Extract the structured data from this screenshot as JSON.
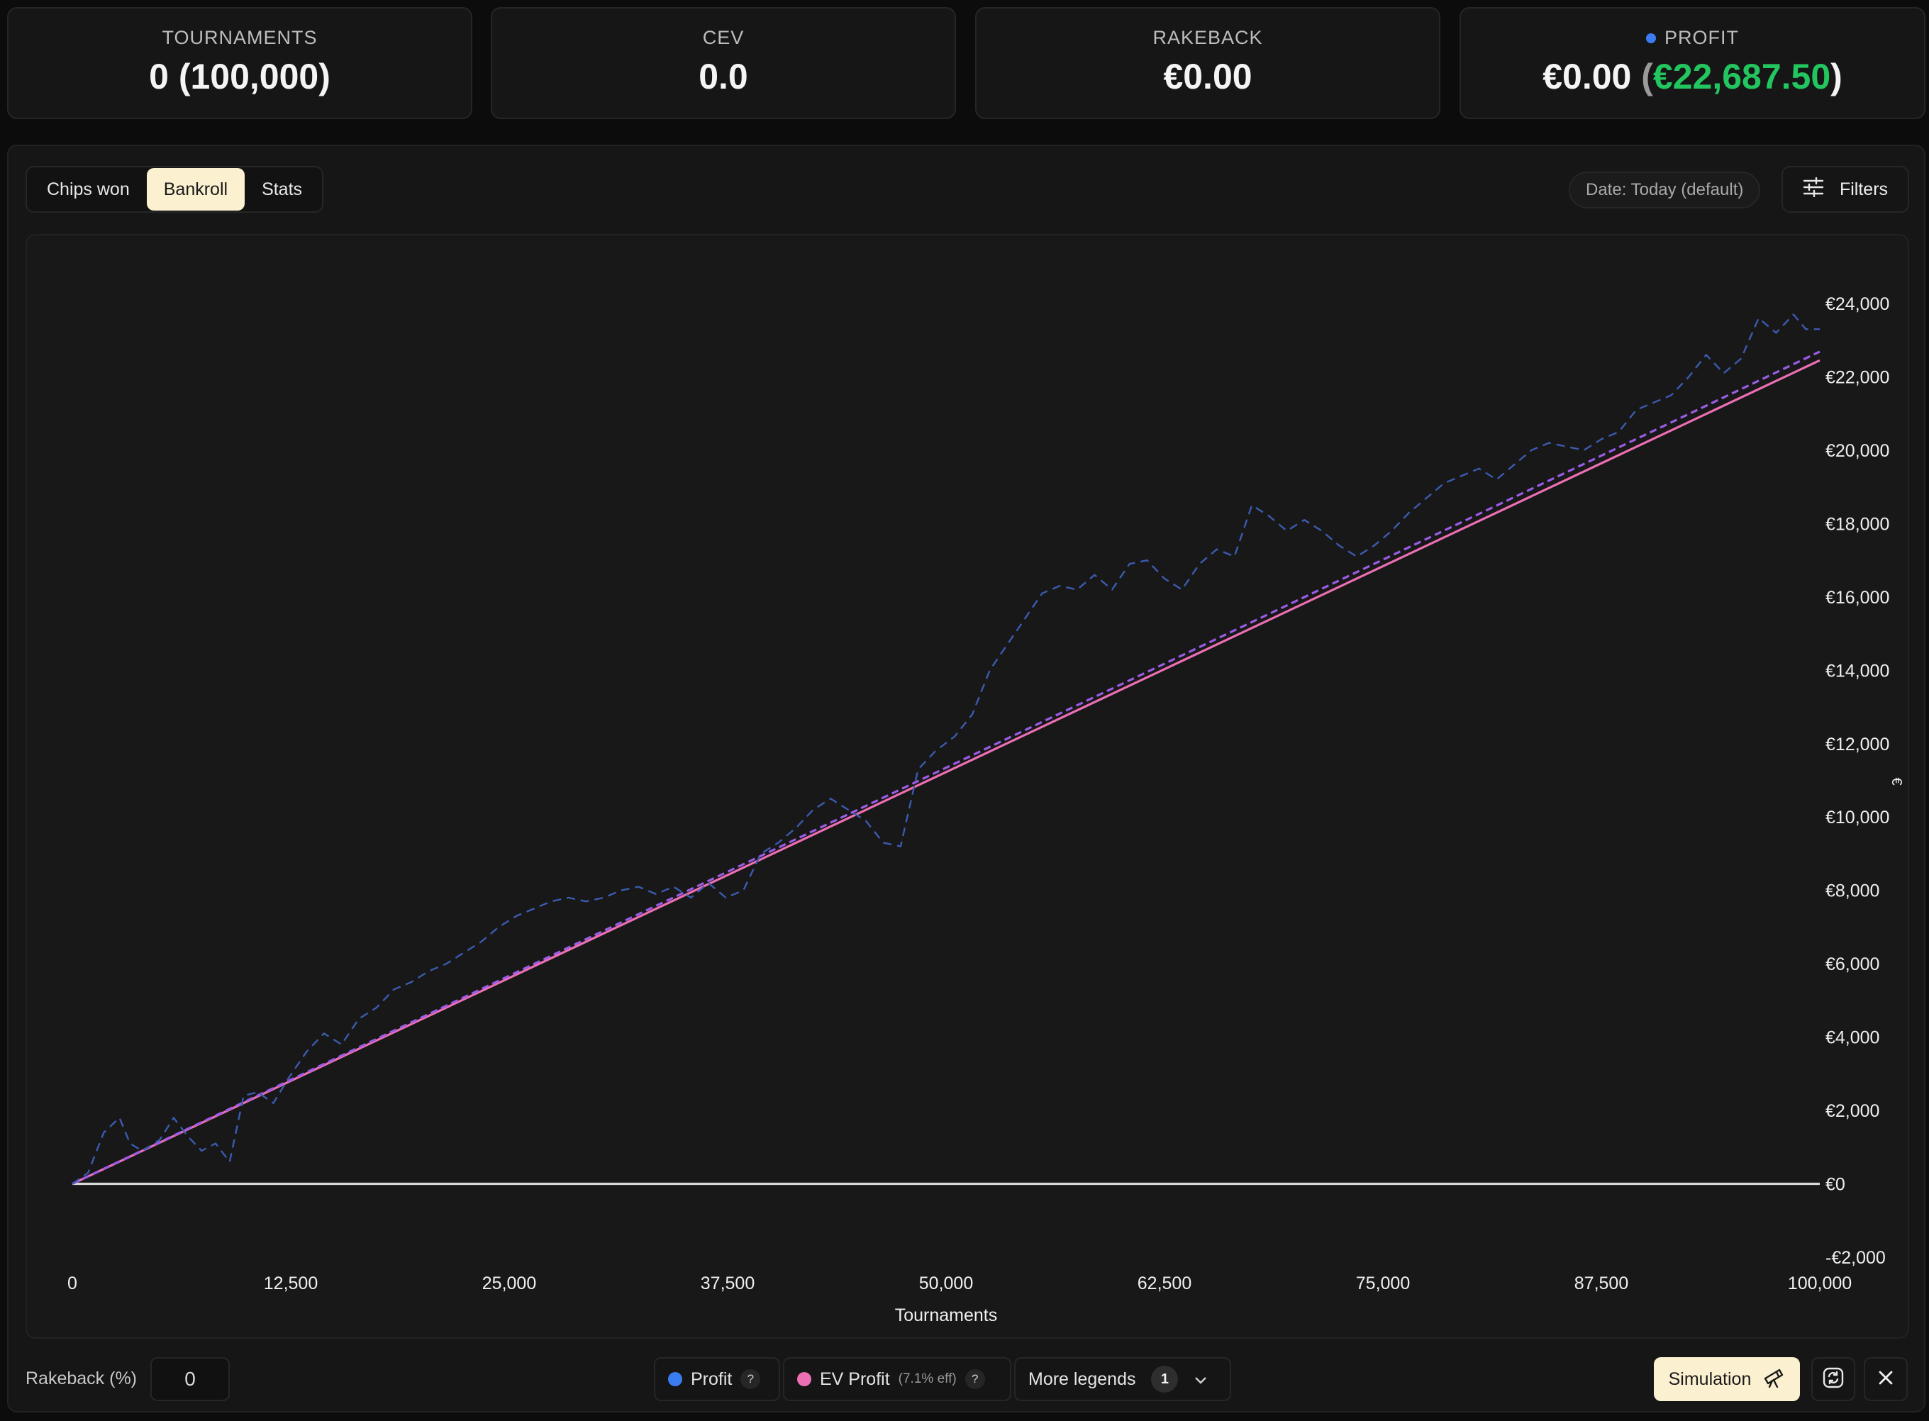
{
  "stats": {
    "tournaments": {
      "label": "TOURNAMENTS",
      "value": "0 (100,000)"
    },
    "cev": {
      "label": "CEV",
      "value": "0.0"
    },
    "rakeback": {
      "label": "RAKEBACK",
      "value": "€0.00"
    },
    "profit": {
      "label": "PROFIT",
      "value": "€0.00",
      "paren_open": "(",
      "expected": "€22,687.50",
      "paren_close": ")",
      "dot_color": "#3b7cf0",
      "expected_color": "#22c55e"
    }
  },
  "tabs": [
    {
      "label": "Chips won",
      "active": false
    },
    {
      "label": "Bankroll",
      "active": true
    },
    {
      "label": "Stats",
      "active": false
    }
  ],
  "date_filter": "Date: Today (default)",
  "filters_label": "Filters",
  "chart_data": {
    "type": "line",
    "xlabel": "Tournaments",
    "ylabel": "€",
    "xlim": [
      0,
      100000
    ],
    "ylim": [
      -2000,
      24000
    ],
    "x_ticks": [
      "0",
      "12,500",
      "25,000",
      "37,500",
      "50,000",
      "62,500",
      "75,000",
      "87,500",
      "100,000"
    ],
    "y_ticks": [
      "€24,000",
      "€22,000",
      "€20,000",
      "€18,000",
      "€16,000",
      "€14,000",
      "€12,000",
      "€10,000",
      "€8,000",
      "€6,000",
      "€4,000",
      "€2,000",
      "€0",
      "-€2,000"
    ],
    "series": [
      {
        "name": "Profit",
        "style": "dashed",
        "color": "#3b5bb0",
        "x": [
          0,
          900,
          1800,
          2700,
          3300,
          4000,
          5000,
          5800,
          6600,
          7400,
          8200,
          9000,
          9800,
          10600,
          11500,
          12400,
          13400,
          14400,
          15400,
          16400,
          17400,
          18400,
          19400,
          20400,
          21400,
          22400,
          23400,
          24400,
          25400,
          26400,
          27400,
          28400,
          29400,
          30400,
          31400,
          32400,
          33400,
          34400,
          35400,
          36400,
          37400,
          38400,
          39400,
          40400,
          41400,
          42400,
          43400,
          44400,
          45400,
          46400,
          47400,
          48400,
          49400,
          50500,
          51500,
          52500,
          53500,
          54500,
          55500,
          56500,
          57500,
          58500,
          59500,
          60500,
          61500,
          62500,
          63500,
          64500,
          65500,
          66500,
          67500,
          68500,
          69500,
          70500,
          71500,
          72500,
          73500,
          74500,
          75500,
          76500,
          77500,
          78500,
          79500,
          80500,
          81500,
          82500,
          83500,
          84500,
          85500,
          86500,
          87500,
          88500,
          89500,
          90500,
          91500,
          92500,
          93500,
          94500,
          95500,
          96500,
          97500,
          98500,
          99200,
          100000
        ],
        "y": [
          0,
          300,
          1400,
          1800,
          1100,
          900,
          1200,
          1800,
          1300,
          900,
          1100,
          600,
          2400,
          2500,
          2200,
          2900,
          3600,
          4100,
          3800,
          4500,
          4800,
          5300,
          5500,
          5800,
          6000,
          6300,
          6600,
          7000,
          7300,
          7500,
          7700,
          7800,
          7700,
          7800,
          8000,
          8100,
          7900,
          8100,
          7800,
          8200,
          7800,
          8000,
          9000,
          9300,
          9700,
          10200,
          10500,
          10200,
          9900,
          9300,
          9200,
          11300,
          11800,
          12200,
          12800,
          14000,
          14700,
          15400,
          16100,
          16300,
          16200,
          16600,
          16200,
          16900,
          17000,
          16500,
          16200,
          16900,
          17300,
          17100,
          18500,
          18200,
          17800,
          18100,
          17800,
          17400,
          17100,
          17400,
          17800,
          18300,
          18700,
          19100,
          19300,
          19500,
          19200,
          19600,
          20000,
          20200,
          20100,
          20000,
          20300,
          20500,
          21100,
          21300,
          21500,
          22000,
          22600,
          22100,
          22500,
          23600,
          23200,
          23700,
          23300,
          23300
        ]
      },
      {
        "name": "EV Profit",
        "style": "solid",
        "color": "#ec6fb3",
        "x": [
          0,
          100000
        ],
        "y": [
          0,
          22450
        ]
      },
      {
        "style": "dashed",
        "color": "#9a5ce6",
        "x": [
          0,
          100000
        ],
        "y": [
          0,
          22687.5
        ]
      },
      {
        "style": "solid",
        "color": "#d9d9d9",
        "x": [
          0,
          100000
        ],
        "y": [
          0,
          0
        ]
      }
    ]
  },
  "bottom": {
    "rakeback_label": "Rakeback (%)",
    "rakeback_value": "0",
    "legend_profit": "Profit",
    "legend_profit_color": "#3b7cf0",
    "legend_ev": "EV Profit",
    "legend_ev_eff": "(7.1% eff)",
    "legend_ev_color": "#ec6fb3",
    "help_glyph": "?",
    "more_legends": "More legends",
    "more_legends_count": "1",
    "simulation_label": "Simulation"
  }
}
